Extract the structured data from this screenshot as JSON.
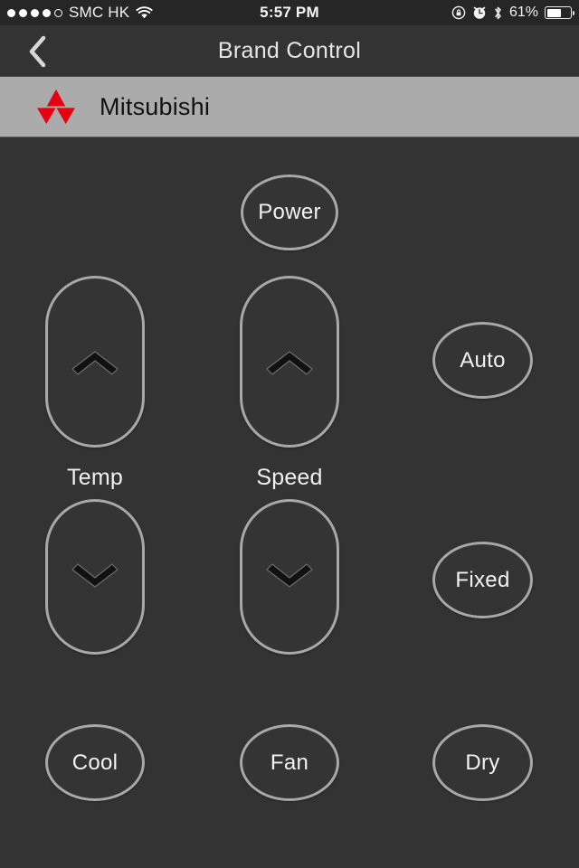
{
  "status_bar": {
    "signal_dots_filled": 4,
    "signal_dots_total": 5,
    "carrier": "SMC HK",
    "wifi_icon": "wifi-icon",
    "time": "5:57 PM",
    "rotation_lock_icon": "rotation-lock-icon",
    "alarm_icon": "alarm-clock-icon",
    "bluetooth_icon": "bluetooth-icon",
    "battery_percent": "61%",
    "battery_level": 61
  },
  "nav_bar": {
    "back_icon": "chevron-left-icon",
    "title": "Brand Control"
  },
  "brand_row": {
    "logo_icon": "mitsubishi-logo-icon",
    "name": "Mitsubishi",
    "background_color": "#ababab",
    "logo_color": "#e60012"
  },
  "controls": {
    "power": {
      "label": "Power",
      "shape": "ellipse"
    },
    "temp_up": {
      "icon": "chevron-up-icon",
      "shape": "pill"
    },
    "temp_down": {
      "icon": "chevron-down-icon",
      "shape": "pill"
    },
    "temp_label": "Temp",
    "speed_up": {
      "icon": "chevron-up-icon",
      "shape": "pill"
    },
    "speed_down": {
      "icon": "chevron-down-icon",
      "shape": "pill"
    },
    "speed_label": "Speed",
    "auto": {
      "label": "Auto",
      "shape": "ellipse"
    },
    "fixed": {
      "label": "Fixed",
      "shape": "ellipse"
    },
    "cool": {
      "label": "Cool",
      "shape": "ellipse"
    },
    "fan": {
      "label": "Fan",
      "shape": "ellipse"
    },
    "dry": {
      "label": "Dry",
      "shape": "ellipse"
    }
  },
  "theme": {
    "background": "#333333",
    "button_border": "#a8a8a8",
    "text": "#f2f2f2",
    "status_bar_bg": "#262626"
  }
}
